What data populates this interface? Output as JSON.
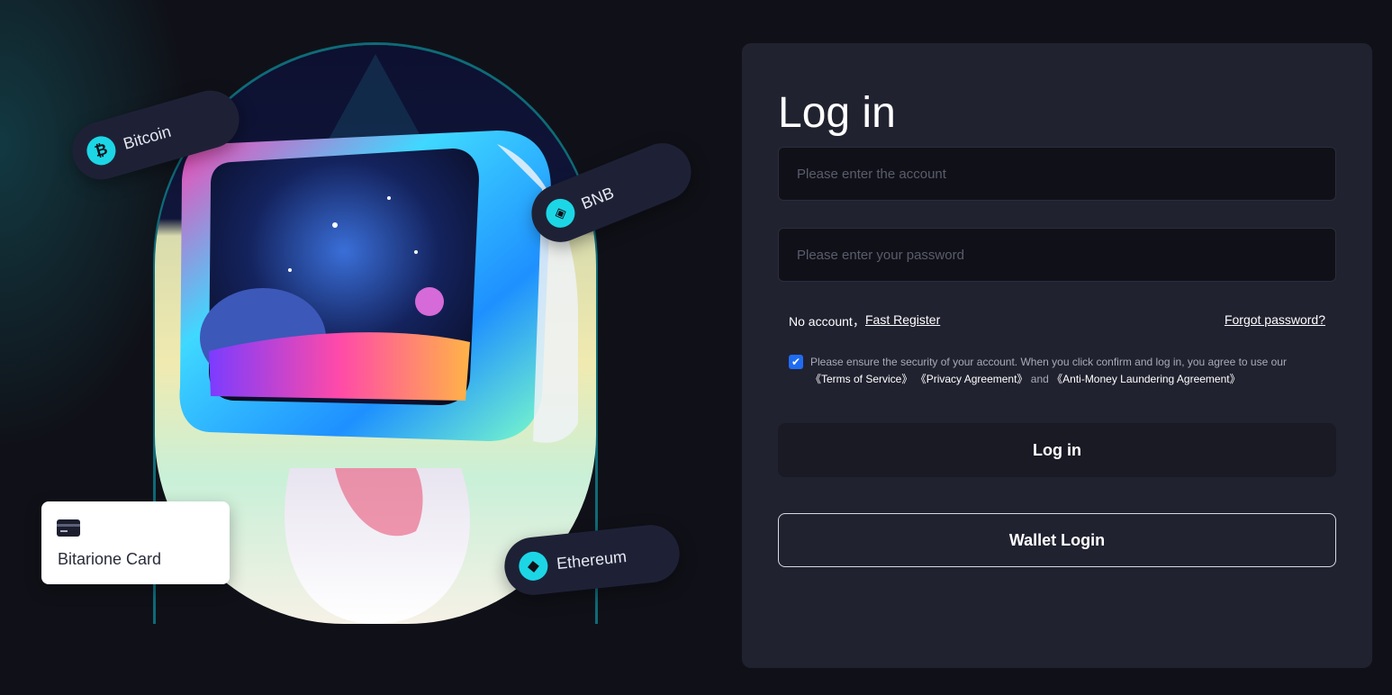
{
  "illustration": {
    "pills": {
      "bitcoin": {
        "label": "Bitcoin",
        "icon": "bitcoin-icon"
      },
      "bnb": {
        "label": "BNB",
        "icon": "bnb-icon"
      },
      "ethereum": {
        "label": "Ethereum",
        "icon": "ethereum-icon"
      }
    },
    "card": {
      "label": "Bitarione Card",
      "icon": "credit-card-icon"
    },
    "accent_color": "#1cd6e6"
  },
  "login": {
    "title": "Log in",
    "account_placeholder": "Please enter the account",
    "password_placeholder": "Please enter your password",
    "no_account_text": "No account，",
    "fast_register_label": "Fast Register",
    "forgot_password_label": "Forgot password?",
    "agreement": {
      "checked": true,
      "text": "Please ensure the security of your account. When you click confirm and log in, you agree to use our",
      "terms_label": "《Terms of Service》",
      "privacy_label": "《Privacy Agreement》",
      "and_text": "and",
      "aml_label": "《Anti-Money Laundering Agreement》"
    },
    "login_button_label": "Log in",
    "wallet_login_button_label": "Wallet Login",
    "checkbox_color": "#1f6cf2"
  }
}
